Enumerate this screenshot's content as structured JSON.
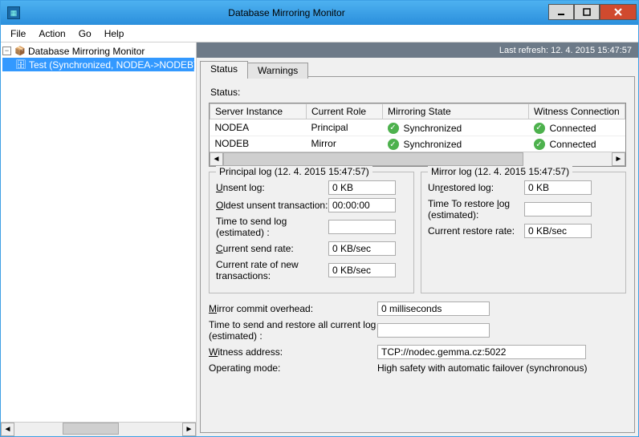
{
  "window": {
    "title": "Database Mirroring Monitor"
  },
  "menu": {
    "file": "File",
    "action": "Action",
    "go": "Go",
    "help": "Help"
  },
  "tree": {
    "root": "Database Mirroring Monitor",
    "child": "Test (Synchronized, NODEA->NODEB)"
  },
  "header": {
    "last_refresh": "Last refresh: 12. 4. 2015 15:47:57"
  },
  "tabs": {
    "status": "Status",
    "warnings": "Warnings"
  },
  "status_label": "Status:",
  "columns": {
    "server": "Server Instance",
    "role": "Current Role",
    "mstate": "Mirroring State",
    "witness": "Witness Connection"
  },
  "rows": [
    {
      "server": "NODEA",
      "role": "Principal",
      "mstate": "Synchronized",
      "witness": "Connected"
    },
    {
      "server": "NODEB",
      "role": "Mirror",
      "mstate": "Synchronized",
      "witness": "Connected"
    }
  ],
  "principal": {
    "legend": "Principal log (12. 4. 2015 15:47:57)",
    "unsent_label": "Unsent log:",
    "unsent": "0 KB",
    "oldest_label": "Oldest unsent transaction:",
    "oldest": "00:00:00",
    "timesend_label": "Time to send log (estimated) :",
    "timesend": "",
    "sendrate_label": "Current send rate:",
    "sendrate": "0 KB/sec",
    "newtrans_label": "Current rate of new transactions:",
    "newtrans": "0 KB/sec"
  },
  "mirror": {
    "legend": "Mirror log (12. 4. 2015 15:47:57)",
    "unrestored_label": "Unrestored log:",
    "unrestored": "0 KB",
    "timerestore_label": "Time To restore log (estimated):",
    "timerestore": "",
    "restorerate_label": "Current restore rate:",
    "restorerate": "0 KB/sec"
  },
  "bottom": {
    "overhead_label": "Mirror commit overhead:",
    "overhead": "0 milliseconds",
    "sendrestore_label": "Time to send and restore all current log (estimated) :",
    "sendrestore": "",
    "witness_label": "Witness address:",
    "witness": "TCP://nodec.gemma.cz:5022",
    "opmode_label": "Operating mode:",
    "opmode": "High safety with automatic failover (synchronous)"
  }
}
